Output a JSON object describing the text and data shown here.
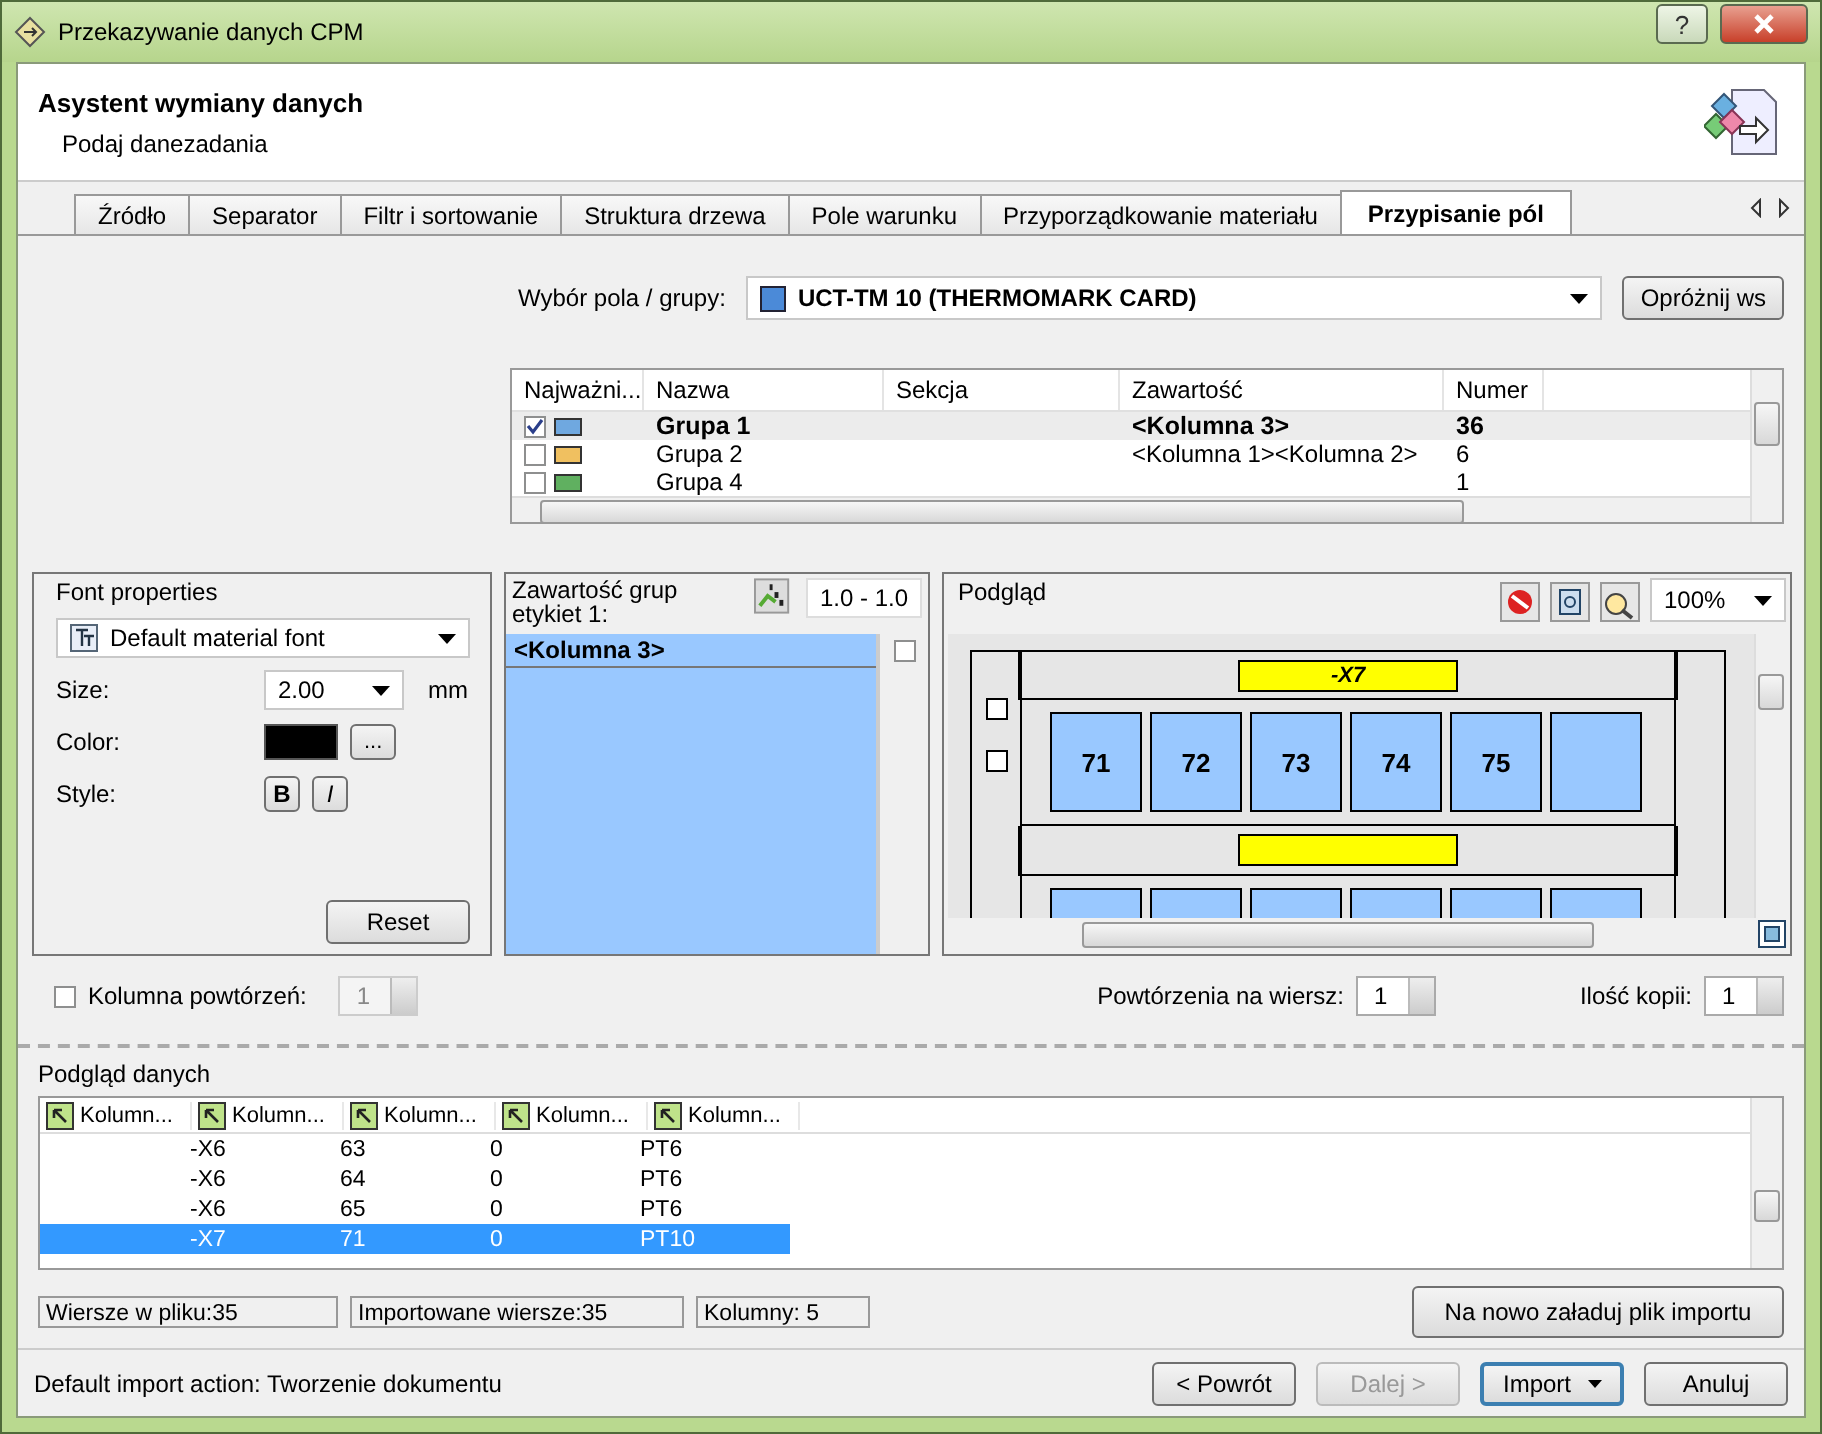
{
  "window": {
    "title": "Przekazywanie danych CPM",
    "help": "?"
  },
  "header": {
    "title": "Asystent wymiany danych",
    "subtitle": "Podaj danezadania"
  },
  "tabs": [
    {
      "label": "Źródło",
      "selected": false
    },
    {
      "label": "Separator",
      "selected": false
    },
    {
      "label": "Filtr i sortowanie",
      "selected": false
    },
    {
      "label": "Struktura drzewa",
      "selected": false
    },
    {
      "label": "Pole warunku",
      "selected": false
    },
    {
      "label": "Przyporządkowanie materiału",
      "selected": false
    },
    {
      "label": "Przypisanie pól",
      "selected": true
    }
  ],
  "field_selector": {
    "label": "Wybór pola / grupy:",
    "value": "UCT-TM 10 (THERMOMARK CARD)",
    "clear_button": "Opróżnij ws"
  },
  "groups_table": {
    "columns": [
      "Najważni...",
      "Nazwa",
      "Sekcja",
      "Zawartość",
      "Numer"
    ],
    "rows": [
      {
        "checked": true,
        "selected": true,
        "color": "#6fa8e0",
        "name": "Grupa 1",
        "content": "<Kolumna 3>",
        "number": "36"
      },
      {
        "checked": false,
        "selected": false,
        "color": "#f0c060",
        "name": "Grupa 2",
        "content": "<Kolumna 1><Kolumna 2>",
        "number": "6"
      },
      {
        "checked": false,
        "selected": false,
        "color": "#60b060",
        "name": "Grupa 4",
        "number": "1"
      }
    ]
  },
  "font_properties": {
    "title": "Font properties",
    "font": "Default material font",
    "size_label": "Size:",
    "size": "2.00",
    "unit": "mm",
    "color_label": "Color:",
    "color": "#000000",
    "color_button": "...",
    "style_label": "Style:",
    "bold_button": "B",
    "italic_button": "I",
    "reset_button": "Reset"
  },
  "group_contents": {
    "title": "Zawartość grup etykiet 1:",
    "range": "1.0 - 1.0",
    "items": [
      {
        "text": "<Kolumna 3>",
        "checked": false
      }
    ]
  },
  "preview": {
    "title": "Podgląd",
    "zoom": "100%",
    "label": "-X7",
    "cells": [
      "71",
      "72",
      "73",
      "74",
      "75"
    ]
  },
  "repeat": {
    "column_label": "Kolumna powtórzeń:",
    "column_checked": false,
    "column_value": "1",
    "per_row_label": "Powtórzenia na wiersz:",
    "per_row_value": "1",
    "copies_label": "Ilość kopii:",
    "copies_value": "1"
  },
  "data_preview": {
    "title": "Podgląd danych",
    "columns": [
      "Kolumn...",
      "Kolumn...",
      "Kolumn...",
      "Kolumn...",
      "Kolumn..."
    ],
    "rows": [
      {
        "cells": [
          "-X6",
          "63",
          "0",
          "PT6"
        ],
        "selected": false
      },
      {
        "cells": [
          "-X6",
          "64",
          "0",
          "PT6"
        ],
        "selected": false
      },
      {
        "cells": [
          "-X6",
          "65",
          "0",
          "PT6"
        ],
        "selected": false
      },
      {
        "cells": [
          "-X7",
          "71",
          "0",
          "PT10"
        ],
        "selected": true
      }
    ]
  },
  "status": [
    "Wiersze w pliku:35",
    "Importowane wiersze:35",
    "Kolumny: 5"
  ],
  "reload_button": "Na nowo załaduj plik importu",
  "footer": {
    "text": "Default import action: Tworzenie dokumentu",
    "buttons": [
      {
        "label": "< Powrót",
        "kind": "plain",
        "disabled": false
      },
      {
        "label": "Dalej >",
        "kind": "plain",
        "disabled": true
      },
      {
        "label": "Import",
        "kind": "split",
        "disabled": false
      },
      {
        "label": "Anuluj",
        "kind": "plain",
        "disabled": false
      }
    ]
  }
}
